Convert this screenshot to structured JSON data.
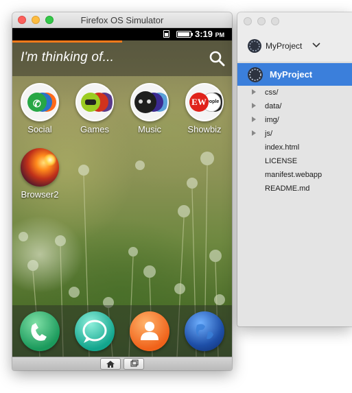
{
  "simulator": {
    "title": "Firefox OS Simulator",
    "status": {
      "time": "3:19",
      "ampm": "PM"
    },
    "search": {
      "placeholder": "I'm thinking of...",
      "progress": 0.5
    },
    "apps": [
      {
        "label": "Social",
        "icon": "social-collection-icon"
      },
      {
        "label": "Games",
        "icon": "games-collection-icon"
      },
      {
        "label": "Music",
        "icon": "music-collection-icon"
      },
      {
        "label": "Showbiz",
        "icon": "showbiz-collection-icon"
      },
      {
        "label": "Browser2",
        "icon": "browser2-app-icon"
      }
    ],
    "showbiz_badges": {
      "ew": "EW",
      "people": "people"
    },
    "dock": [
      "phone-icon",
      "messages-icon",
      "contacts-icon",
      "browser-icon"
    ],
    "softkeys": [
      "home-icon",
      "cards-view-icon"
    ]
  },
  "project_panel": {
    "selector_label": "MyProject",
    "selected_project": "MyProject",
    "tree": [
      {
        "label": "css/",
        "type": "folder"
      },
      {
        "label": "data/",
        "type": "folder"
      },
      {
        "label": "img/",
        "type": "folder"
      },
      {
        "label": "js/",
        "type": "folder"
      },
      {
        "label": "index.html",
        "type": "file"
      },
      {
        "label": "LICENSE",
        "type": "file"
      },
      {
        "label": "manifest.webapp",
        "type": "file"
      },
      {
        "label": "README.md",
        "type": "file"
      }
    ]
  },
  "colors": {
    "selection": "#3b7fdb",
    "search_progress": "#ff7a1a",
    "traffic_close": "#fc605c",
    "traffic_min": "#fdbc40",
    "traffic_max": "#34c84a"
  }
}
